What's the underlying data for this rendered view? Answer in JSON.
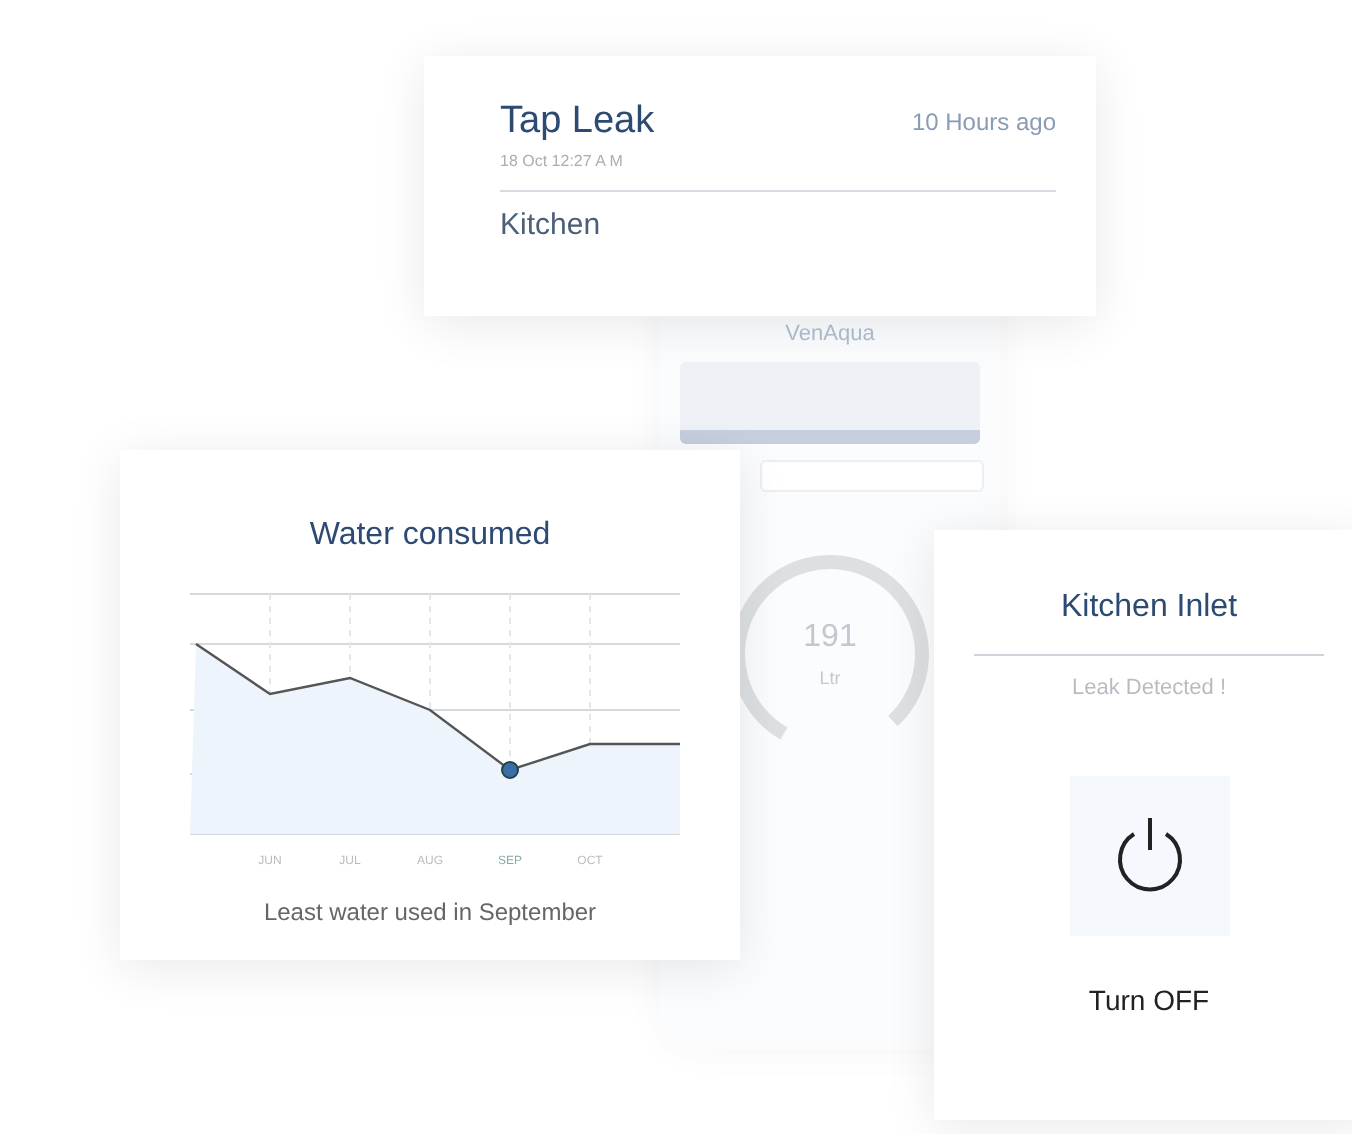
{
  "phone": {
    "brand": "VenAqua",
    "gauge_reading": "191",
    "gauge_unit": "Ltr"
  },
  "alert_card": {
    "title": "Tap Leak",
    "time_ago": "10 Hours ago",
    "timestamp": "18 Oct 12:27 A M",
    "location": "Kitchen"
  },
  "chart_card": {
    "title": "Water consumed",
    "months": [
      {
        "label": "JUN",
        "selected": false
      },
      {
        "label": "JUL",
        "selected": false
      },
      {
        "label": "AUG",
        "selected": false
      },
      {
        "label": "SEP",
        "selected": true
      },
      {
        "label": "OCT",
        "selected": false
      }
    ],
    "caption": "Least water used in September"
  },
  "valve_card": {
    "title": "Kitchen Inlet",
    "status": "Leak Detected !",
    "button_label": "Turn OFF"
  }
}
